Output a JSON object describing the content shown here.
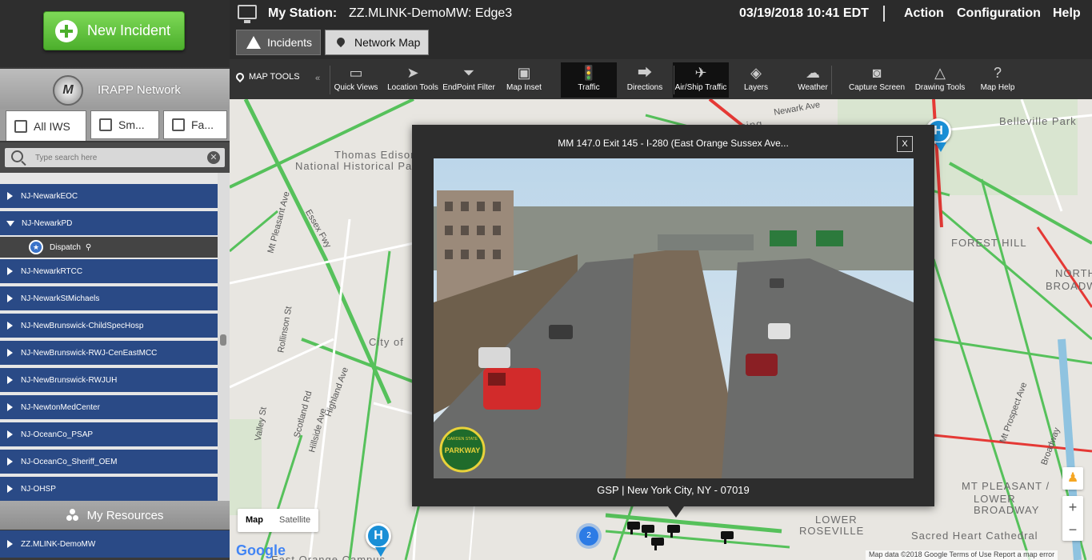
{
  "sidebar": {
    "new_incident_label": "New Incident",
    "network_title": "IRAPP Network",
    "network_logo_letter": "M",
    "tabs": [
      {
        "label": "All IWS",
        "active": true
      },
      {
        "label": "Sm...",
        "active": false
      },
      {
        "label": "Fa...",
        "active": false
      }
    ],
    "search_placeholder": "Type search here",
    "items": [
      {
        "label": "NJ-NewarkEOC",
        "expanded": false
      },
      {
        "label": "NJ-NewarkPD",
        "expanded": true
      },
      {
        "label": "NJ-NewarkRTCC",
        "expanded": false
      },
      {
        "label": "NJ-NewarkStMichaels",
        "expanded": false
      },
      {
        "label": "NJ-NewBrunswick-ChildSpecHosp",
        "expanded": false
      },
      {
        "label": "NJ-NewBrunswick-RWJ-CenEastMCC",
        "expanded": false
      },
      {
        "label": "NJ-NewBrunswick-RWJUH",
        "expanded": false
      },
      {
        "label": "NJ-NewtonMedCenter",
        "expanded": false
      },
      {
        "label": "NJ-OceanCo_PSAP",
        "expanded": false
      },
      {
        "label": "NJ-OceanCo_Sheriff_OEM",
        "expanded": false
      },
      {
        "label": "NJ-OHSP",
        "expanded": false
      }
    ],
    "subitem": {
      "label": "Dispatch"
    },
    "my_resources_label": "My Resources",
    "resource_item": "ZZ.MLINK-DemoMW"
  },
  "header": {
    "station_label": "My Station:",
    "station_name": "ZZ.MLINK-DemoMW: Edge3",
    "datetime": "03/19/2018 10:41 EDT",
    "menu": [
      "Action",
      "Configuration",
      "Help"
    ]
  },
  "tabs": [
    {
      "label": "Incidents",
      "active": false
    },
    {
      "label": "Network Map",
      "active": true
    }
  ],
  "map_toolbar": {
    "map_tools_label": "MAP TOOLS",
    "collapse_glyph": "«",
    "tools": [
      {
        "label": "Quick Views",
        "icon": "quick-views-icon",
        "glyph": "▭",
        "active": false
      },
      {
        "label": "Location Tools",
        "icon": "location-tools-icon",
        "glyph": "➤",
        "active": false
      },
      {
        "label": "EndPoint Filter",
        "icon": "funnel-icon",
        "glyph": "⏷",
        "active": false
      },
      {
        "label": "Map Inset",
        "icon": "map-inset-icon",
        "glyph": "▣",
        "active": false
      },
      {
        "label": "Traffic",
        "icon": "traffic-light-icon",
        "glyph": "🚦",
        "active": true
      },
      {
        "label": "Directions",
        "icon": "directions-icon",
        "glyph": "⮕",
        "active": false
      },
      {
        "label": "Air/Ship Traffic",
        "icon": "plane-ship-icon",
        "glyph": "✈",
        "active": true
      },
      {
        "label": "Layers",
        "icon": "layers-icon",
        "glyph": "◈",
        "active": false
      },
      {
        "label": "Weather",
        "icon": "weather-icon",
        "glyph": "☁",
        "active": false
      },
      {
        "label": "Capture Screen",
        "icon": "camera-icon",
        "glyph": "◙",
        "active": false
      },
      {
        "label": "Drawing Tools",
        "icon": "drawing-tools-icon",
        "glyph": "△",
        "active": false
      },
      {
        "label": "Map Help",
        "icon": "help-icon",
        "glyph": "?",
        "active": false
      }
    ]
  },
  "map": {
    "labels": [
      {
        "text": "Watsessing",
        "style": "big"
      },
      {
        "text": "Newark Ave",
        "style": "road"
      },
      {
        "text": "Belleville Park",
        "style": "big"
      },
      {
        "text": "Thomas Edison",
        "style": "big"
      },
      {
        "text": "National Historical Park",
        "style": "big"
      },
      {
        "text": "FOREST HILL",
        "style": "big"
      },
      {
        "text": "NORTH",
        "style": "big"
      },
      {
        "text": "BROADW",
        "style": "big"
      },
      {
        "text": "City of",
        "style": "big"
      },
      {
        "text": "Mt Pleasant Ave",
        "style": "road"
      },
      {
        "text": "Essex Fwy",
        "style": "road"
      },
      {
        "text": "Rollinson St",
        "style": "road"
      },
      {
        "text": "Highland Ave",
        "style": "road"
      },
      {
        "text": "Scotland Rd",
        "style": "road"
      },
      {
        "text": "Hillside Ave",
        "style": "road"
      },
      {
        "text": "Valley St",
        "style": "road"
      },
      {
        "text": "MT PLEASANT /",
        "style": "big"
      },
      {
        "text": "LOWER",
        "style": "big"
      },
      {
        "text": "BROADWAY",
        "style": "big"
      },
      {
        "text": "LOWER",
        "style": "big"
      },
      {
        "text": "ROSEVILLE",
        "style": "big"
      },
      {
        "text": "Sacred Heart Cathedral",
        "style": "big"
      },
      {
        "text": "East Orange Campus",
        "style": "big"
      },
      {
        "text": "Broadway",
        "style": "road"
      },
      {
        "text": "Mt Prospect Ave",
        "style": "road"
      }
    ],
    "cluster_count": "2",
    "hospital_letter": "H",
    "map_type": {
      "map": "Map",
      "satellite": "Satellite"
    },
    "attribution": "Map data ©2018 Google   Terms of Use   Report a map error",
    "zoom_in": "+",
    "zoom_out": "−",
    "google": "Google"
  },
  "camera_popup": {
    "title": "MM 147.0 Exit 145 - I-280 (East Orange Sussex Ave...",
    "close_label": "X",
    "caption": "GSP | New York City, NY - 07019",
    "overlay_logo": "PARKWAY",
    "overlay_logo_top": "GARDEN STATE"
  },
  "colors": {
    "sidebar_item_bg": "#2a4a86",
    "new_incident_green": "#5cbf34",
    "traffic_green": "#56c15b",
    "traffic_red": "#e53935",
    "hospital_pin": "#1a8fd6"
  }
}
